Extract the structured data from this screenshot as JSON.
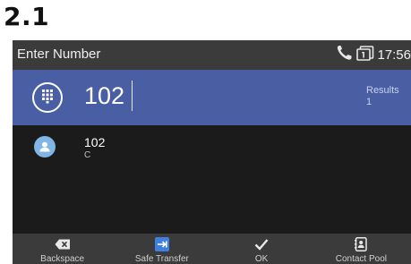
{
  "section_label": "2.1",
  "status_bar": {
    "title": "Enter Number",
    "time": "17:56",
    "icons": [
      "call-icon",
      "line-icon"
    ]
  },
  "entry": {
    "dialpad_icon": "dialpad-icon",
    "number": "102",
    "results_label": "Results",
    "results_count": "1"
  },
  "results": [
    {
      "icon": "contact-icon",
      "number": "102",
      "subtitle": "C"
    }
  ],
  "softkeys": [
    {
      "label": "Backspace",
      "icon": "backspace-icon"
    },
    {
      "label": "Safe Transfer",
      "icon": "transfer-icon"
    },
    {
      "label": "OK",
      "icon": "check-icon"
    },
    {
      "label": "Contact Pool",
      "icon": "contact-book-icon"
    }
  ],
  "colors": {
    "accent": "#4a5ea3",
    "bar": "#3b3b3b",
    "background": "#1b1b1b",
    "transfer_icon": "#3f7fe0",
    "call_icon": "#e8e8e8"
  }
}
